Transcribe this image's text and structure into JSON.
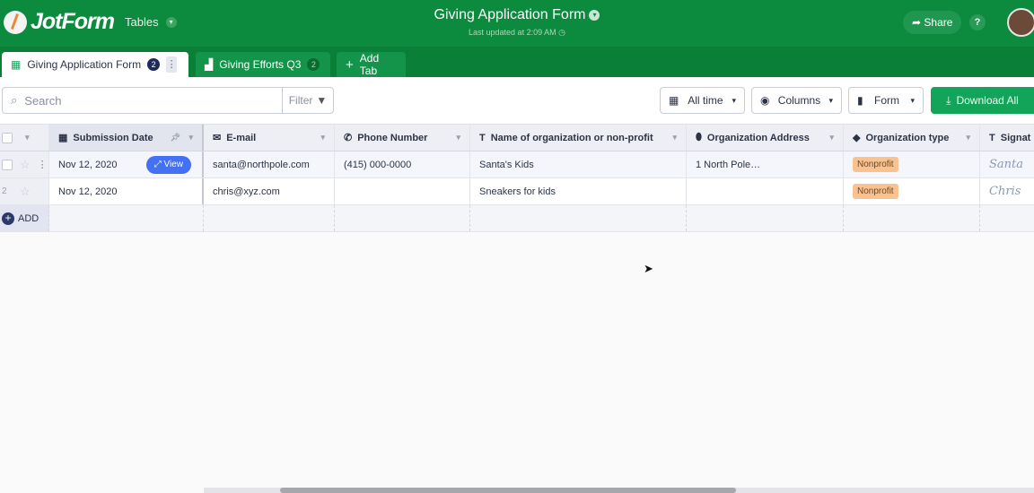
{
  "app": {
    "logo": "JotForm",
    "product": "Tables",
    "title": "Giving Application Form",
    "updated": "Last updated at 2:09 AM",
    "share": "Share",
    "help": "?"
  },
  "tabs": [
    {
      "label": "Giving Application Form",
      "count": "2"
    },
    {
      "label": "Giving Efforts Q3",
      "count": "2"
    },
    {
      "label": "Add Tab"
    }
  ],
  "toolbar": {
    "search_placeholder": "Search",
    "filter": "Filter",
    "time": "All time",
    "columns": "Columns",
    "form": "Form",
    "download": "Download All"
  },
  "columns": [
    "Submission Date",
    "E-mail",
    "Phone Number",
    "Name of organization or non-profit",
    "Organization Address",
    "Organization type",
    "Signat"
  ],
  "rows": [
    {
      "num": "",
      "date": "Nov 12, 2020",
      "email": "santa@northpole.com",
      "phone": "(415) 000-0000",
      "name": "Santa's Kids",
      "address": "1 North Pole…",
      "type": "Nonprofit",
      "signature": "Santa"
    },
    {
      "num": "2",
      "date": "Nov 12, 2020",
      "email": "chris@xyz.com",
      "phone": "",
      "name": "Sneakers for kids",
      "address": "",
      "type": "Nonprofit",
      "signature": "Chris"
    }
  ],
  "view_label": "View",
  "add_label": "ADD",
  "colors": {
    "brand": "#0c8a3e",
    "accent": "#4470f4",
    "download": "#12a55a",
    "tag": "#f9c290"
  }
}
